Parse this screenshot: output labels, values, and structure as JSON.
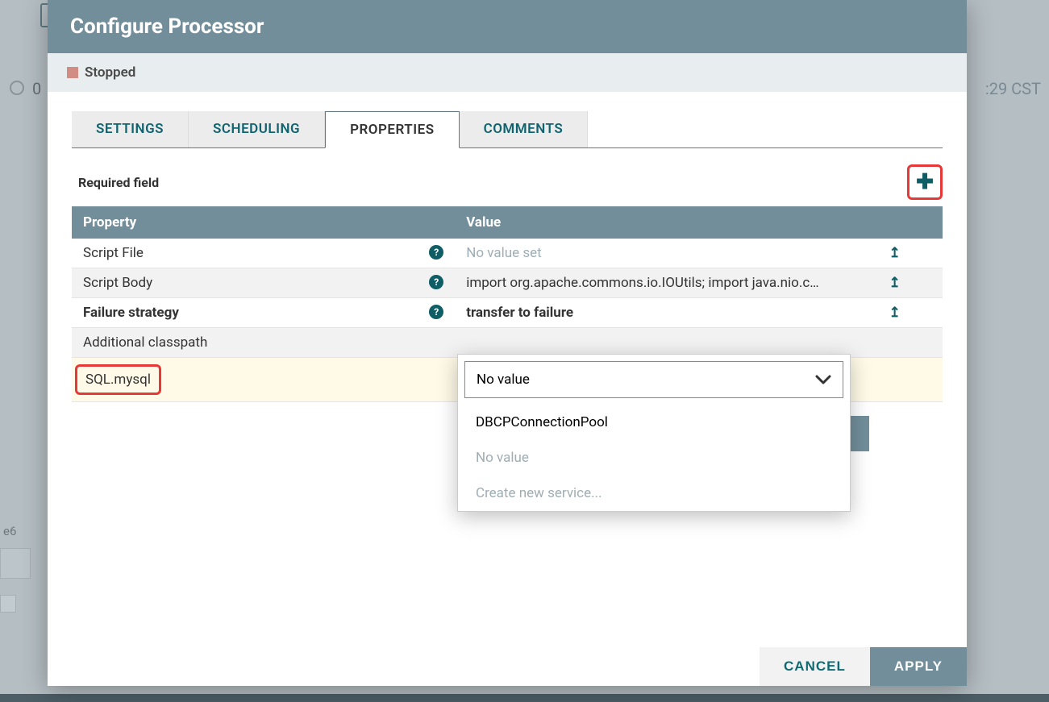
{
  "bg": {
    "timestamp_suffix": ":29 CST",
    "zero": "0",
    "e6": "e6"
  },
  "modal": {
    "title": "Configure Processor",
    "status_label": "Stopped"
  },
  "tabs": {
    "settings": "SETTINGS",
    "scheduling": "SCHEDULING",
    "properties": "PROPERTIES",
    "comments": "COMMENTS"
  },
  "req_label": "Required field",
  "table": {
    "headers": {
      "property": "Property",
      "value": "Value"
    },
    "rows": [
      {
        "name": "Script File",
        "value": "No value set",
        "bold": false,
        "muted": true,
        "help": true,
        "action": true
      },
      {
        "name": "Script Body",
        "value": "import org.apache.commons.io.IOUtils; import java.nio.c…",
        "bold": false,
        "muted": false,
        "help": true,
        "action": true
      },
      {
        "name": "Failure strategy",
        "value": "transfer to failure",
        "bold": true,
        "muted": false,
        "help": true,
        "action": true
      },
      {
        "name": "Additional classpath",
        "value": "",
        "bold": false,
        "muted": false,
        "help": false,
        "action": false
      },
      {
        "name": "SQL.mysql",
        "value": "",
        "bold": false,
        "muted": false,
        "help": false,
        "action": false
      }
    ]
  },
  "dropdown": {
    "selected": "No value",
    "options": [
      {
        "label": "DBCPConnectionPool",
        "muted": false
      },
      {
        "label": "No value",
        "muted": true
      },
      {
        "label": "Create new service...",
        "muted": true
      }
    ]
  },
  "buttons": {
    "cancel": "CANCEL",
    "apply": "APPLY"
  }
}
